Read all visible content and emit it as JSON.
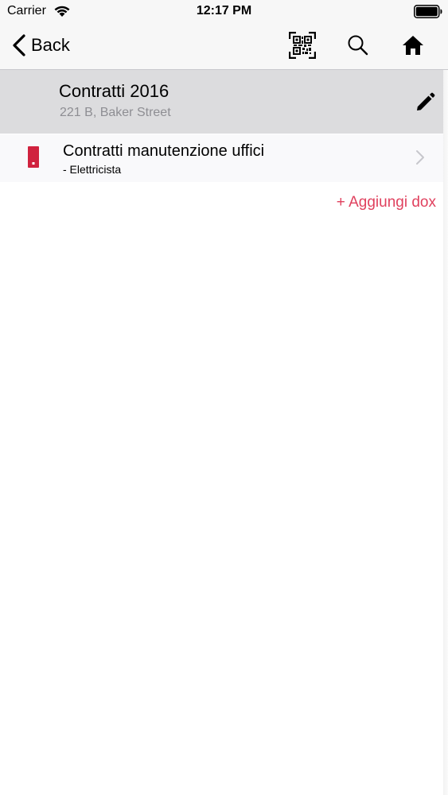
{
  "status_bar": {
    "carrier": "Carrier",
    "time": "12:17 PM",
    "wifi_icon": "wifi-icon",
    "battery_icon": "battery-icon"
  },
  "nav_bar": {
    "back_label": "Back",
    "back_icon": "chevron-left-icon",
    "qr_icon": "qr-code-icon",
    "search_icon": "search-icon",
    "home_icon": "home-icon"
  },
  "folder": {
    "title": "Contratti 2016",
    "subtitle": "221 B, Baker Street",
    "edit_icon": "pencil-icon"
  },
  "documents": [
    {
      "title": "Contratti manutenzione uffici",
      "subtitle": "- Elettricista",
      "badge_color": "#d0223e",
      "chevron_icon": "chevron-right-icon"
    }
  ],
  "add_link": "+ Aggiungi dox",
  "colors": {
    "accent": "#e0415e",
    "header_background": "#dcdcde",
    "badge": "#d0223e"
  }
}
